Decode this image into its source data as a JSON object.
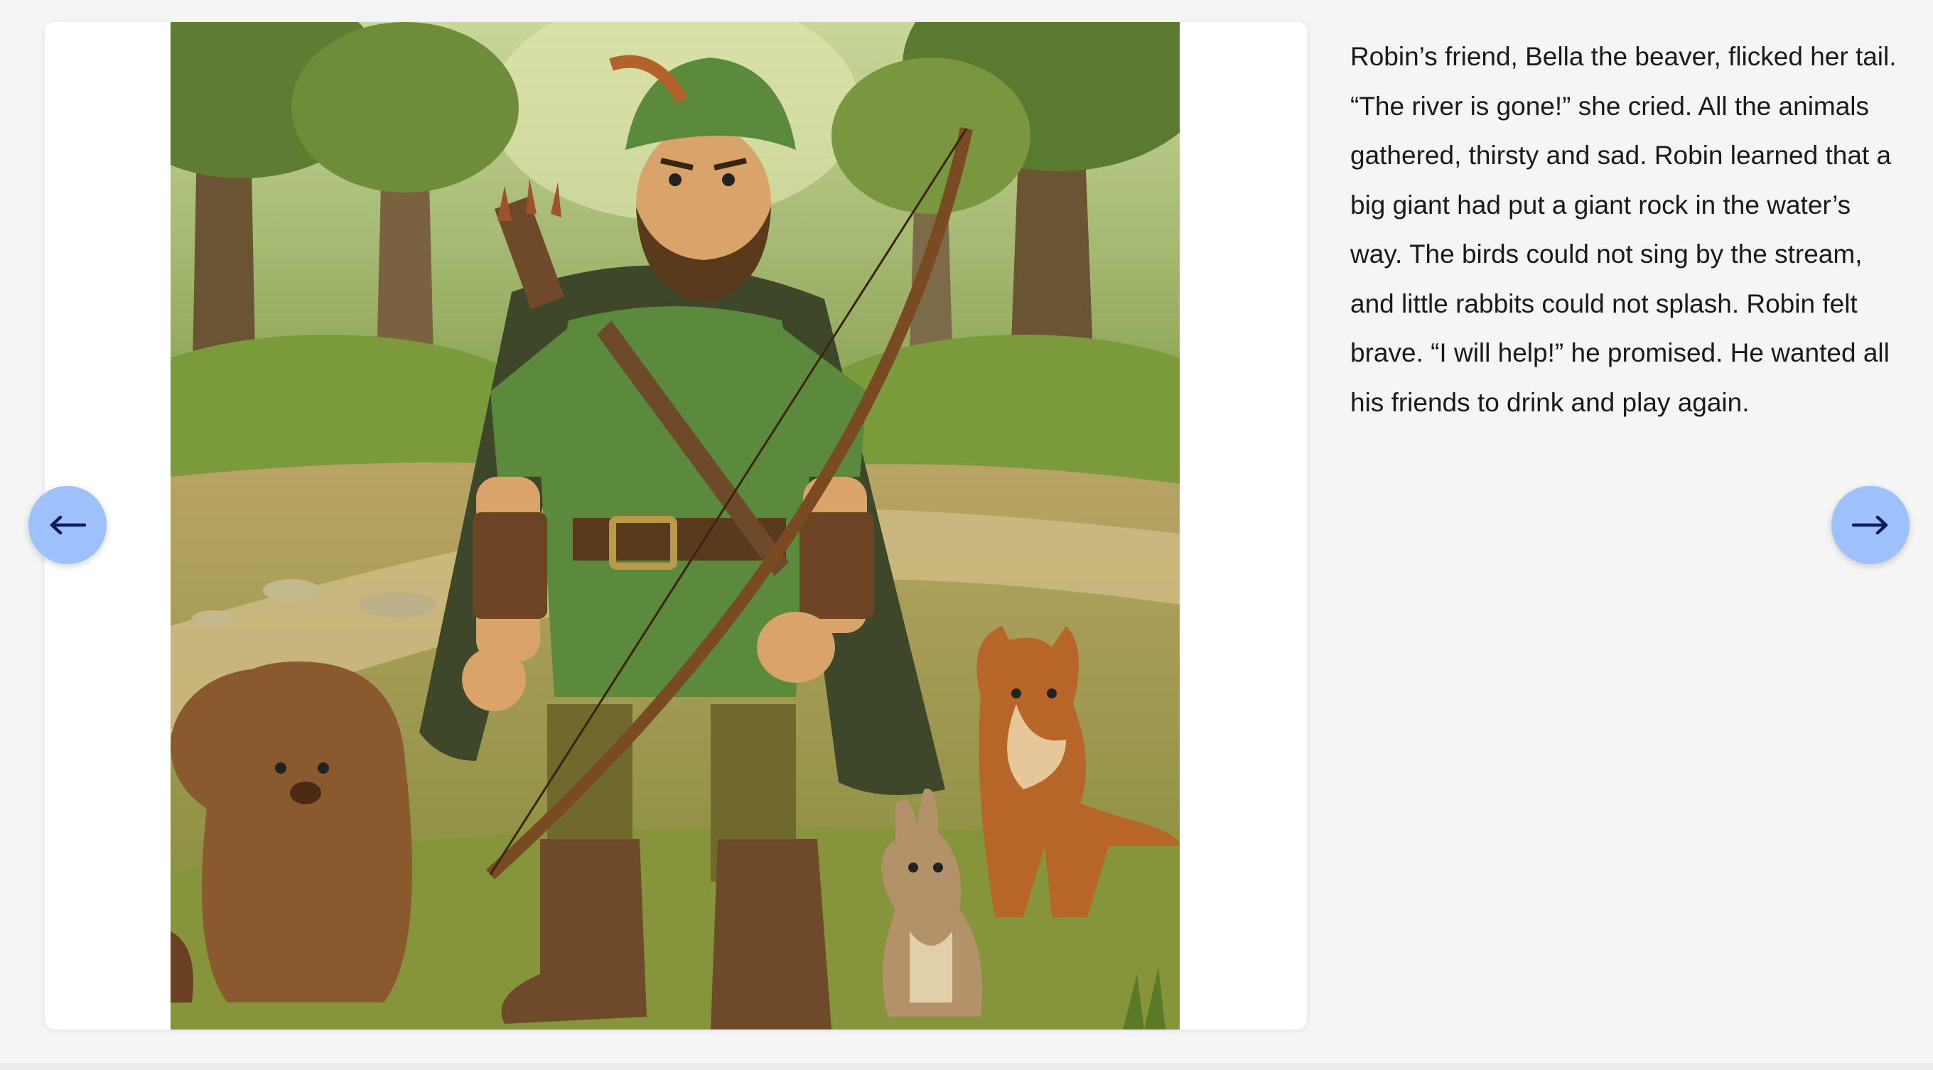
{
  "story": {
    "paragraph": "Robin’s friend, Bella the beaver, flicked her tail. “The river is gone!” she cried. All the animals gathered, thirsty and sad. Robin learned that a big giant had put a giant rock in the water’s way. The birds could not sing by the stream, and little rabbits could not splash. Robin felt brave. “I will help!” he promised. He wanted all his friends to drink and play again."
  },
  "navigation": {
    "prev_icon": "arrow-left-icon",
    "next_icon": "arrow-right-icon"
  },
  "colors": {
    "nav_button": "#9cc1fb",
    "nav_arrow": "#0d1b5e",
    "text": "#1a1a1a"
  }
}
